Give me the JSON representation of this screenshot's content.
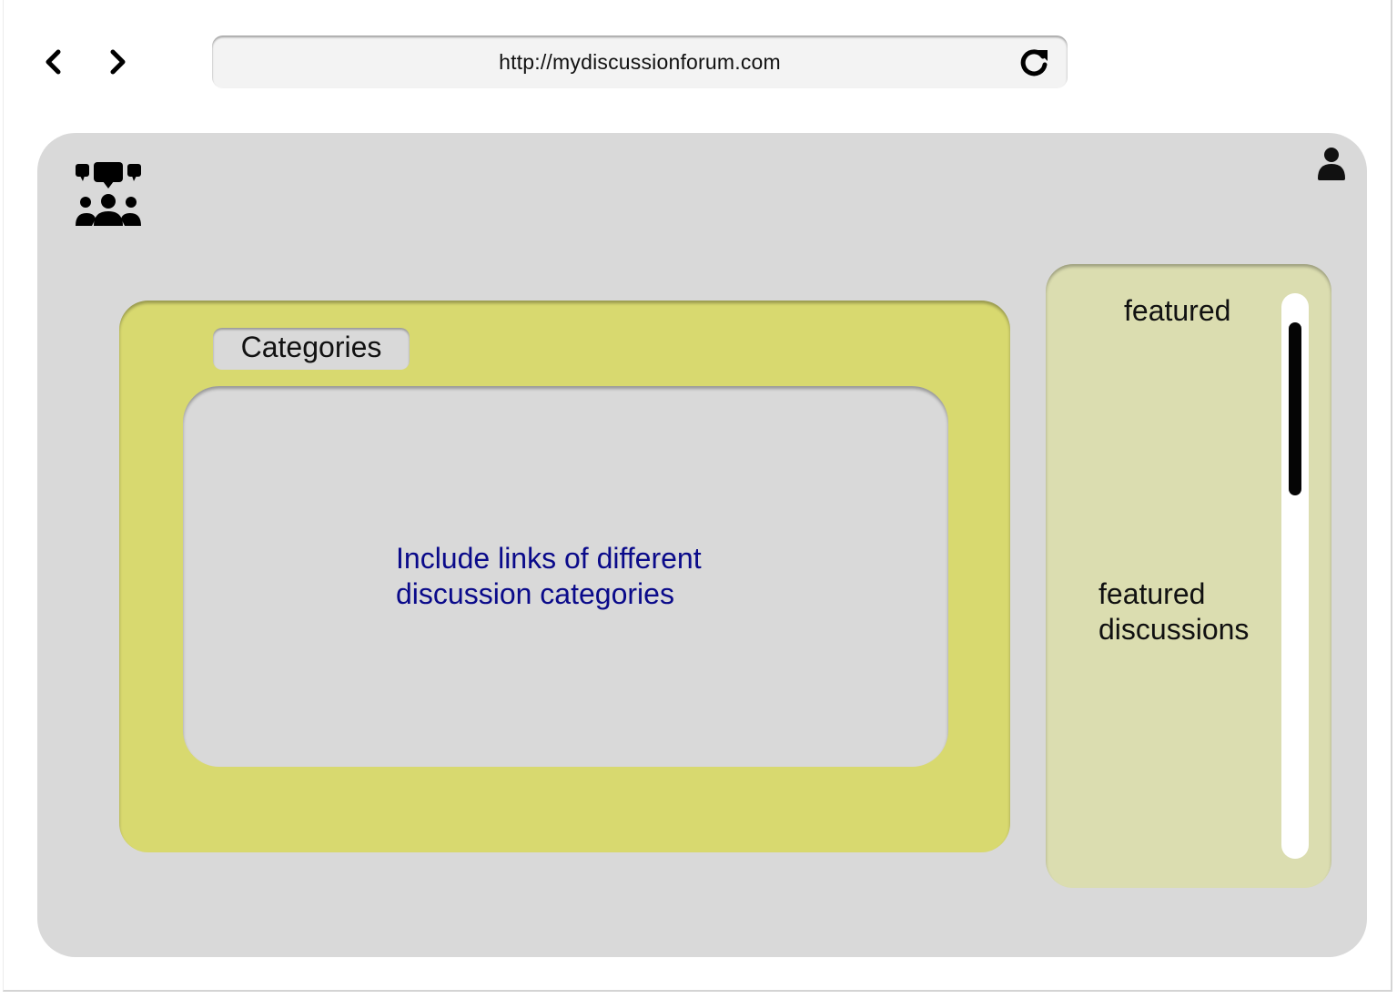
{
  "browser": {
    "url": "http://mydiscussionforum.com",
    "back_icon": "chevron-left-icon",
    "forward_icon": "chevron-right-icon",
    "reload_icon": "reload-icon"
  },
  "header": {
    "logo_icon": "discussion-group-icon",
    "user_icon": "user-icon"
  },
  "categories": {
    "label": "Categories",
    "note": "Include links of different discussion categories"
  },
  "featured": {
    "title": "featured",
    "body": "featured discussions",
    "scroll_position": 0.2
  },
  "colors": {
    "page_bg": "#d9d9d9",
    "categories_panel": "#d8d96f",
    "featured_panel": "#dbddb0",
    "note_text": "#0a0a8a"
  }
}
